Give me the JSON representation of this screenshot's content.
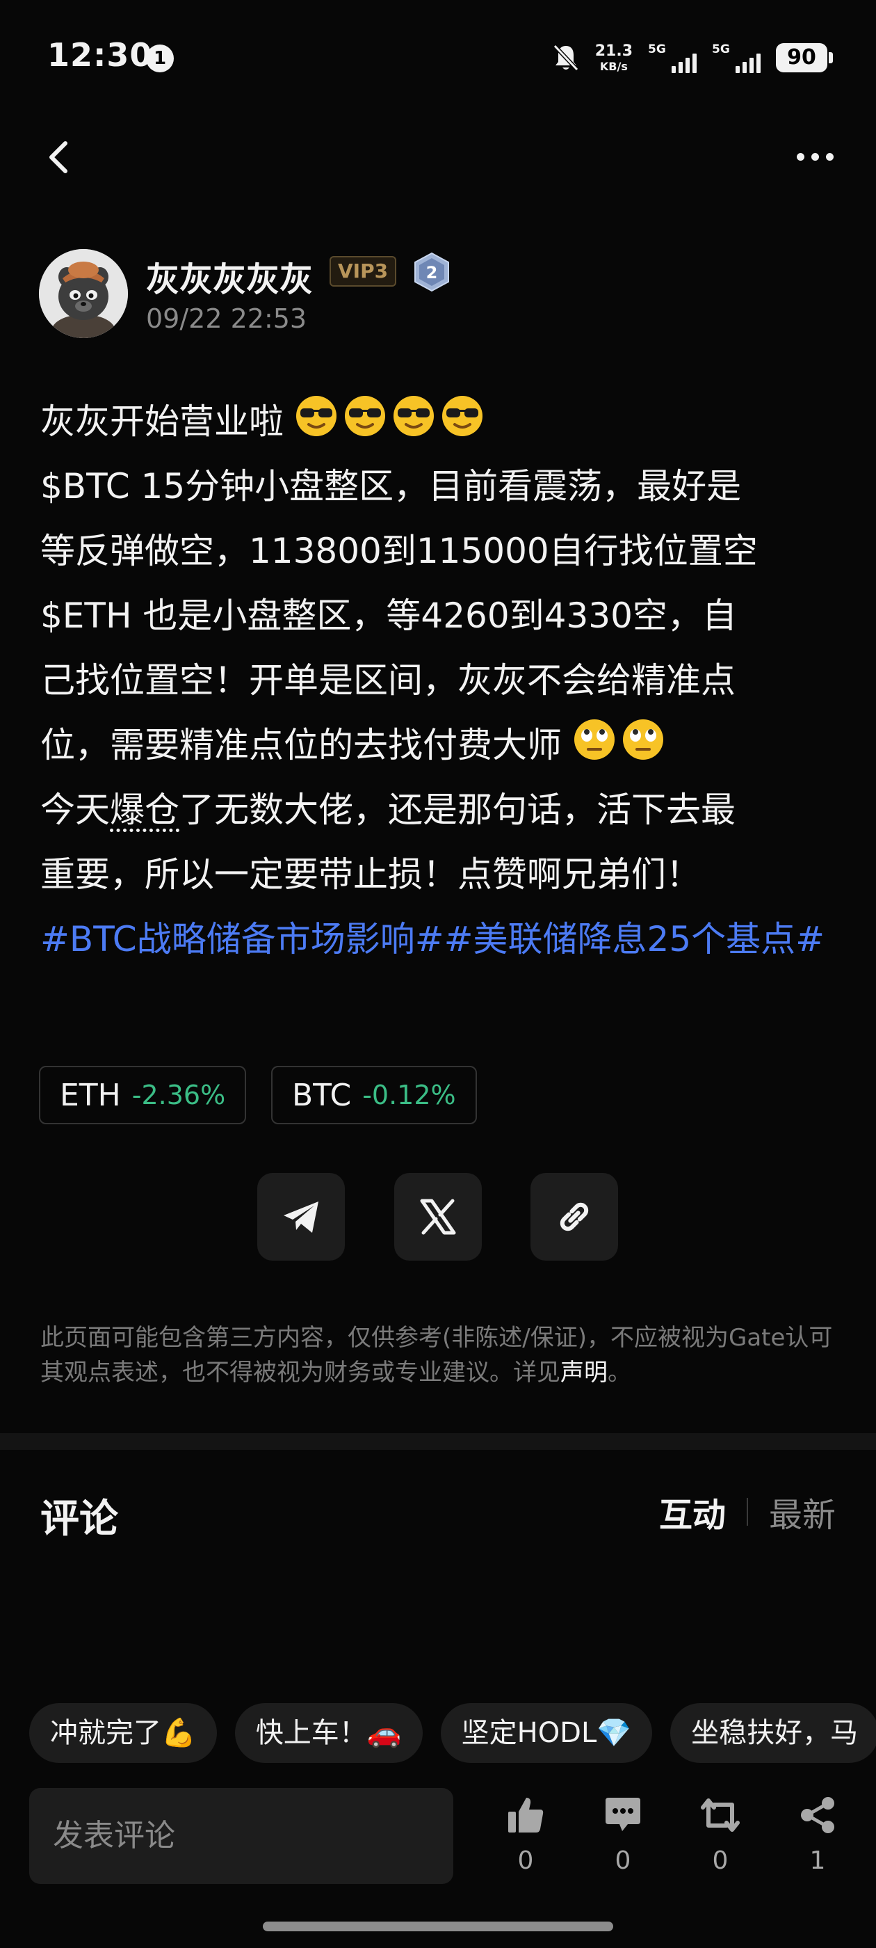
{
  "status_bar": {
    "time": "12:30",
    "notification_count": "1",
    "net_speed_value": "21.3",
    "net_speed_unit": "KB/s",
    "sim1_label": "5G",
    "sim2_label": "5G",
    "battery": "90"
  },
  "author": {
    "name": "灰灰灰灰灰",
    "vip": "VIP3",
    "level": "2",
    "time": "09/22 22:53"
  },
  "post": {
    "lines": [
      "灰灰开始营业啦",
      "$BTC 15分钟小盘整区，目前看震荡，最好是",
      "等反弹做空，113800到115000自行找位置空",
      "$ETH 也是小盘整区，等4260到4330空，自",
      "己找位置空！开单是区间，灰灰不会给精准点",
      "位，需要精准点位的去找付费大师",
      "爆仓",
      "了无数大佬，还是那句话，活下去最",
      "重要，所以一定要带止损！点赞啊兄弟们！"
    ],
    "line7_prefix": "今天",
    "tags": "#BTC战略储备市场影响##美联储降息25个基点#"
  },
  "coins": [
    {
      "symbol": "ETH",
      "change": "-2.36%"
    },
    {
      "symbol": "BTC",
      "change": "-0.12%"
    }
  ],
  "disclaimer": {
    "text": "此页面可能包含第三方内容，仅供参考(非陈述/保证)，不应被视为Gate认可其观点表述，也不得被视为财务或专业建议。详见",
    "link": "声明",
    "end": "。"
  },
  "comments": {
    "title": "评论",
    "sort_active": "互动",
    "sort_inactive": "最新"
  },
  "quick_replies": [
    "冲就完了💪",
    "快上车！🚗",
    "坚定HODL💎",
    "坐稳扶好，马"
  ],
  "bottom_bar": {
    "input_placeholder": "发表评论",
    "like_count": "0",
    "comment_count": "0",
    "repost_count": "0",
    "share_count": "1"
  },
  "colors": {
    "background": "#070707",
    "tag_blue": "#4c7bf4",
    "positive_green": "#3bbd86",
    "vip_gold": "#b8955a"
  },
  "icons": [
    "back-icon",
    "more-icon",
    "telegram-icon",
    "x-icon",
    "link-icon",
    "like-icon",
    "comment-icon",
    "repost-icon",
    "share-icon"
  ]
}
